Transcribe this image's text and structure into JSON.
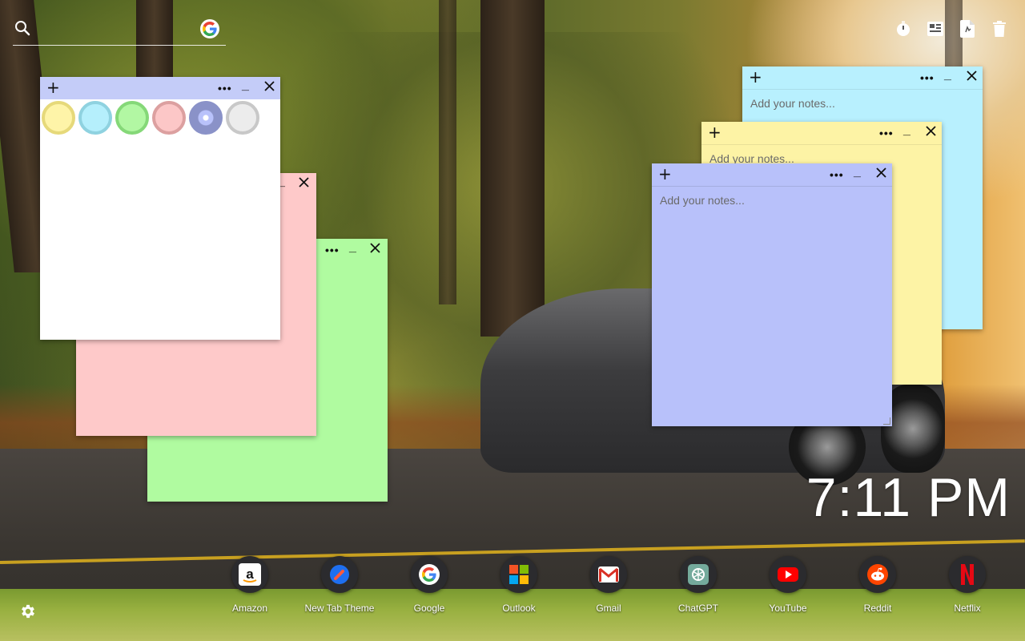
{
  "search": {
    "placeholder": ""
  },
  "top_icons": [
    "timer-icon",
    "widgets-icon",
    "notes-icon",
    "trash-icon"
  ],
  "notes": [
    {
      "id": "green",
      "color": "#b0fba0",
      "placeholder": ""
    },
    {
      "id": "pink",
      "color": "#fec9c9",
      "placeholder": ""
    },
    {
      "id": "white",
      "color": "#ffffff",
      "header_color": "#c4ccf8",
      "placeholder": ""
    },
    {
      "id": "cyan",
      "color": "#b8f0fe",
      "placeholder": "Add your notes..."
    },
    {
      "id": "yellow",
      "color": "#fdf3a5",
      "placeholder": "Add your notes..."
    },
    {
      "id": "blue",
      "color": "#b8c1fa",
      "placeholder": "Add your notes..."
    }
  ],
  "color_swatches": [
    {
      "name": "yellow",
      "fill": "#fef4a8",
      "ring": "#e6d97a"
    },
    {
      "name": "cyan",
      "fill": "#b5effc",
      "ring": "#8fd2e0"
    },
    {
      "name": "green",
      "fill": "#b2f7a3",
      "ring": "#85d878"
    },
    {
      "name": "pink",
      "fill": "#fcc7c7",
      "ring": "#dca0a0"
    },
    {
      "name": "blue",
      "fill": "#b9c2fb",
      "ring": "#8a92c8",
      "selected": true
    },
    {
      "name": "white",
      "fill": "#ececec",
      "ring": "#c8c8c8"
    }
  ],
  "clock": {
    "time": "7:11 PM"
  },
  "dock": [
    {
      "label": "Amazon",
      "icon": "amazon-icon"
    },
    {
      "label": "New Tab Theme",
      "icon": "new-tab-theme-icon"
    },
    {
      "label": "Google",
      "icon": "google-icon"
    },
    {
      "label": "Outlook",
      "icon": "outlook-icon"
    },
    {
      "label": "Gmail",
      "icon": "gmail-icon"
    },
    {
      "label": "ChatGPT",
      "icon": "chatgpt-icon"
    },
    {
      "label": "YouTube",
      "icon": "youtube-icon"
    },
    {
      "label": "Reddit",
      "icon": "reddit-icon"
    },
    {
      "label": "Netflix",
      "icon": "netflix-icon"
    }
  ]
}
